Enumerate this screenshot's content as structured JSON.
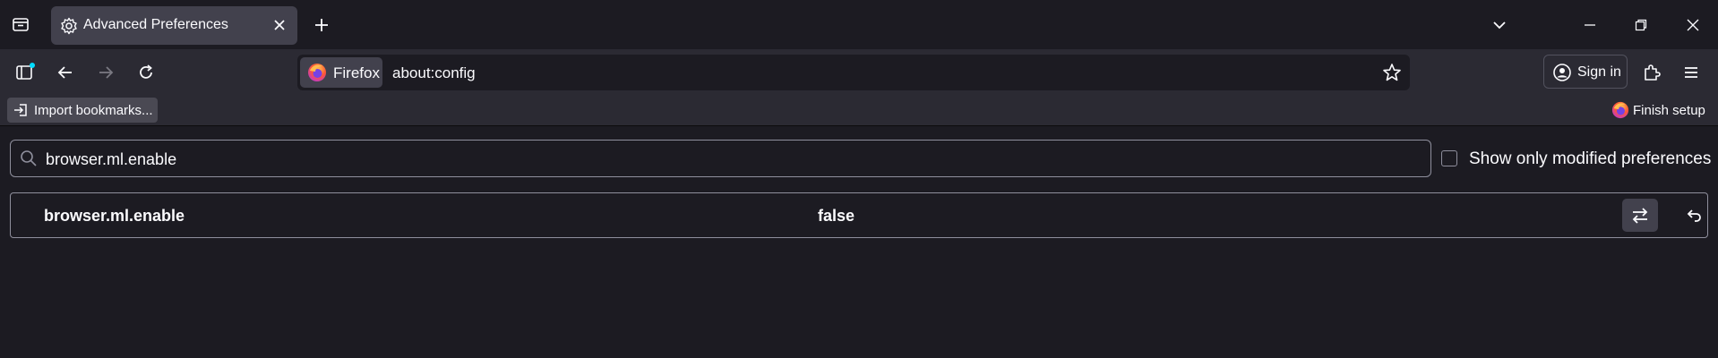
{
  "tab": {
    "title": "Advanced Preferences",
    "icon": "gear-icon"
  },
  "navbar": {
    "identity_label": "Firefox",
    "url": "about:config",
    "signin_label": "Sign in"
  },
  "bookmarks": {
    "import_label": "Import bookmarks...",
    "finish_label": "Finish setup"
  },
  "config": {
    "search_value": "browser.ml.enable",
    "modified_label": "Show only modified preferences",
    "modified_checked": false,
    "preferences": [
      {
        "name": "browser.ml.enable",
        "value": "false"
      }
    ]
  },
  "colors": {
    "background": "#1c1b22",
    "toolbar": "#2b2a33",
    "selected_tab": "#42414d",
    "accent_dot": "#00ddff"
  }
}
